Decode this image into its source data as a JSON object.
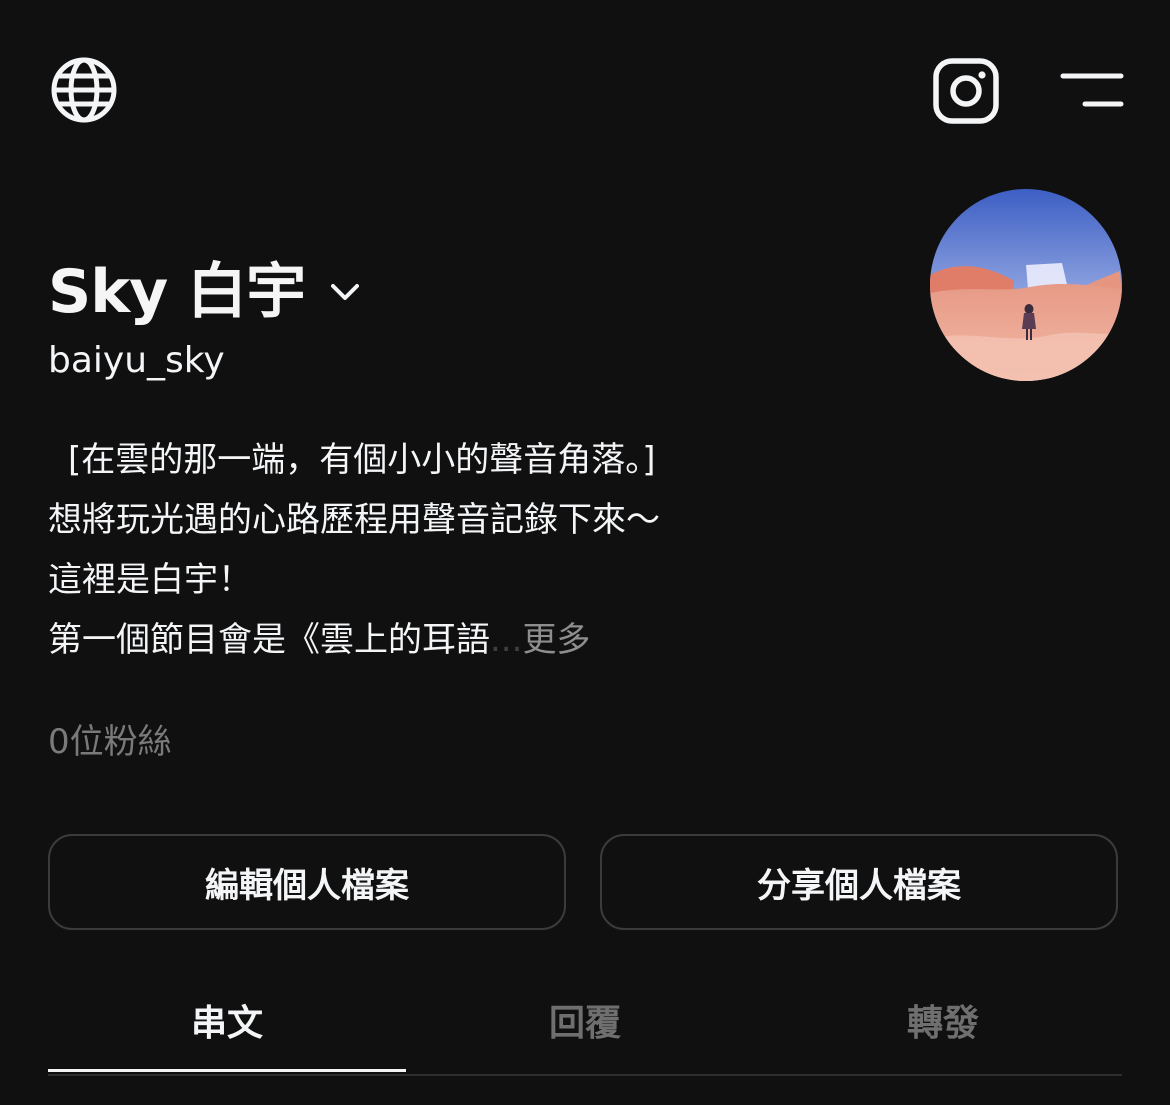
{
  "topbar": {
    "left_icon": "globe-icon",
    "right_icons": [
      "instagram-icon",
      "menu-icon"
    ]
  },
  "profile": {
    "display_name": "Sky 白宇",
    "handle": "baiyu_sky",
    "bio_lines": [
      "[在雲的那一端，有個小小的聲音角落。]",
      "想將玩光遇的心路歷程用聲音記錄下來～",
      "這裡是白宇！",
      "第一個節目會是《雲上的耳語"
    ],
    "bio_ellipsis": "...",
    "bio_more": "更多",
    "followers": "0位粉絲"
  },
  "buttons": {
    "edit": "編輯個人檔案",
    "share": "分享個人檔案"
  },
  "tabs": [
    {
      "label": "串文",
      "active": true
    },
    {
      "label": "回覆",
      "active": false
    },
    {
      "label": "轉發",
      "active": false
    }
  ],
  "colors": {
    "background": "#101010",
    "text": "#f3f5f7",
    "muted": "#7a7a7a",
    "border": "#3b3b3b"
  }
}
